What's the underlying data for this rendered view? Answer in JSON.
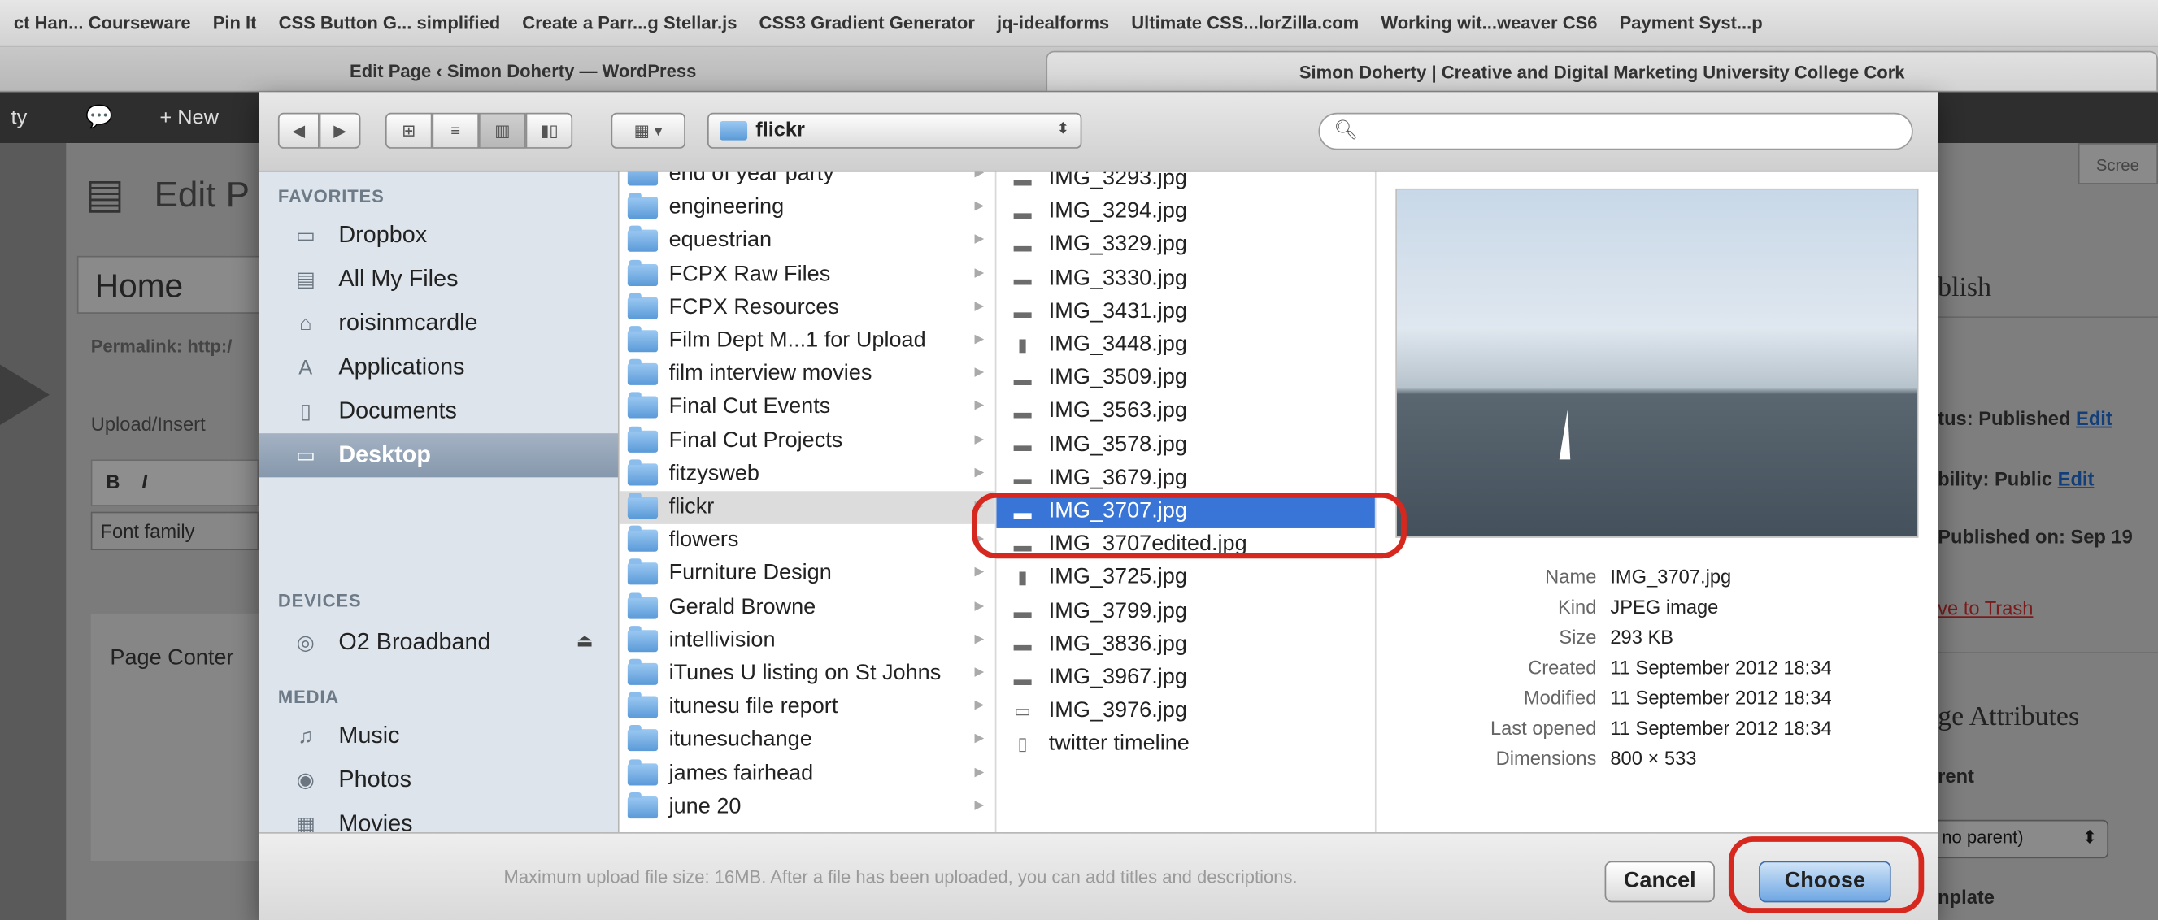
{
  "browser": {
    "bookmarks": [
      "ct Han... Courseware",
      "Pin It",
      "CSS Button G... simplified",
      "Create a Parr...g Stellar.js",
      "CSS3 Gradient Generator",
      "jq-idealforms",
      "Ultimate CSS...lorZilla.com",
      "Working wit...weaver CS6",
      "Payment Syst...p"
    ],
    "tabs": [
      "Edit Page ‹ Simon Doherty — WordPress",
      "Simon Doherty | Creative and Digital Marketing University College Cork"
    ]
  },
  "wp": {
    "bar_item_site": "ty",
    "bar_item_new": "+ New",
    "page_heading": "Edit P",
    "title_value": "Home",
    "permalink": "Permalink: http:/",
    "upload_insert": "Upload/Insert",
    "font_family": "Font family",
    "page_content": "Page Conter",
    "publish": "blish",
    "status": "tus: Published",
    "status_edit": "Edit",
    "visibility": "bility: Public",
    "visibility_edit": "Edit",
    "published_on": "Published on: Sep 19",
    "trash": "ve to Trash",
    "page_attributes": "ge Attributes",
    "parent_label": "rent",
    "parent_value": "no parent)",
    "template_label": "nplate",
    "screen_options": "Scree",
    "upload_note": "Maximum upload file size: 16MB. After a file has been uploaded, you can add titles and descriptions."
  },
  "dialog": {
    "current_folder": "flickr",
    "search_placeholder": "",
    "sidebar": {
      "favorites_header": "FAVORITES",
      "favorites": [
        {
          "label": "Dropbox",
          "icon": "folder-icon"
        },
        {
          "label": "All My Files",
          "icon": "all-files-icon"
        },
        {
          "label": "roisinmcardle",
          "icon": "home-icon"
        },
        {
          "label": "Applications",
          "icon": "applications-icon"
        },
        {
          "label": "Documents",
          "icon": "documents-icon"
        },
        {
          "label": "Desktop",
          "icon": "desktop-icon",
          "selected": true
        }
      ],
      "devices_header": "DEVICES",
      "devices": [
        {
          "label": "O2 Broadband",
          "icon": "disk-icon"
        }
      ],
      "media_header": "MEDIA",
      "media": [
        {
          "label": "Music",
          "icon": "music-icon"
        },
        {
          "label": "Photos",
          "icon": "camera-icon"
        },
        {
          "label": "Movies",
          "icon": "film-icon"
        }
      ]
    },
    "folders": [
      "end of year party",
      "engineering",
      "equestrian",
      "FCPX Raw Files",
      "FCPX Resources",
      "Film Dept M...1 for Upload",
      "film interview movies",
      "Final Cut Events",
      "Final Cut Projects",
      "fitzysweb",
      "flickr",
      "flowers",
      "Furniture Design",
      "Gerald Browne",
      "intellivision",
      "iTunes U listing on St Johns",
      "itunesu file report",
      "itunesuchange",
      "james fairhead",
      "june 20"
    ],
    "selected_folder_index": 10,
    "files": [
      "IMG_3293.jpg",
      "IMG_3294.jpg",
      "IMG_3329.jpg",
      "IMG_3330.jpg",
      "IMG_3431.jpg",
      "IMG_3448.jpg",
      "IMG_3509.jpg",
      "IMG_3563.jpg",
      "IMG_3578.jpg",
      "IMG_3679.jpg",
      "IMG_3707.jpg",
      "IMG_3707edited.jpg",
      "IMG_3725.jpg",
      "IMG_3799.jpg",
      "IMG_3836.jpg",
      "IMG_3967.jpg",
      "IMG_3976.jpg",
      "twitter timeline"
    ],
    "selected_file_index": 10,
    "info": [
      {
        "key": "Name",
        "value": "IMG_3707.jpg"
      },
      {
        "key": "Kind",
        "value": "JPEG image"
      },
      {
        "key": "Size",
        "value": "293 KB"
      },
      {
        "key": "Created",
        "value": "11 September 2012 18:34"
      },
      {
        "key": "Modified",
        "value": "11 September 2012 18:34"
      },
      {
        "key": "Last opened",
        "value": "11 September 2012 18:34"
      },
      {
        "key": "Dimensions",
        "value": "800 × 533"
      }
    ],
    "cancel_label": "Cancel",
    "choose_label": "Choose",
    "highlight_color": "#d6281e",
    "selection_color": "#3875d7"
  }
}
